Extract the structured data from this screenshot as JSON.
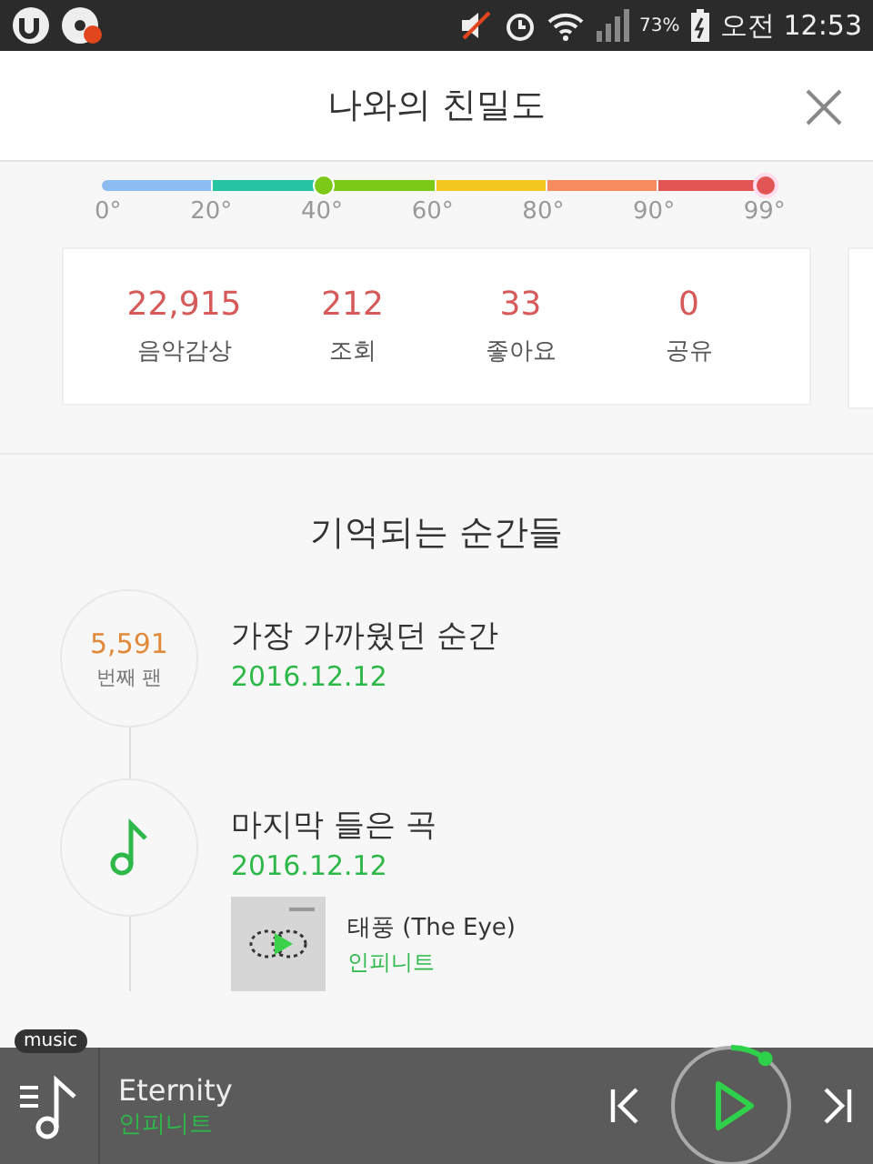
{
  "status_bar": {
    "battery": "73%",
    "ampm": "오전",
    "time": "12:53"
  },
  "header": {
    "title": "나와의 친밀도"
  },
  "meter": {
    "segments": [
      {
        "color": "#8dbdf0"
      },
      {
        "color": "#27c4a4"
      },
      {
        "color": "#7cc917"
      },
      {
        "color": "#f2c81e"
      },
      {
        "color": "#f58b5e"
      },
      {
        "color": "#e25555"
      }
    ],
    "scale": [
      "0°",
      "20°",
      "40°",
      "60°",
      "80°",
      "90°",
      "99°"
    ]
  },
  "stats": [
    {
      "value": "22,915",
      "label": "음악감상"
    },
    {
      "value": "212",
      "label": "조회"
    },
    {
      "value": "33",
      "label": "좋아요"
    },
    {
      "value": "0",
      "label": "공유"
    }
  ],
  "section_title": "기억되는 순간들",
  "timeline": [
    {
      "kind": "rank",
      "value": "5,591",
      "caption": "번째 팬",
      "title": "가장 가까웠던 순간",
      "date": "2016.12.12"
    },
    {
      "kind": "song",
      "title": "마지막 들은 곡",
      "date": "2016.12.12",
      "track": {
        "title": "태풍 (The Eye)",
        "artist": "인피니트"
      }
    }
  ],
  "player": {
    "badge": "music",
    "title": "Eternity",
    "artist": "인피니트"
  }
}
